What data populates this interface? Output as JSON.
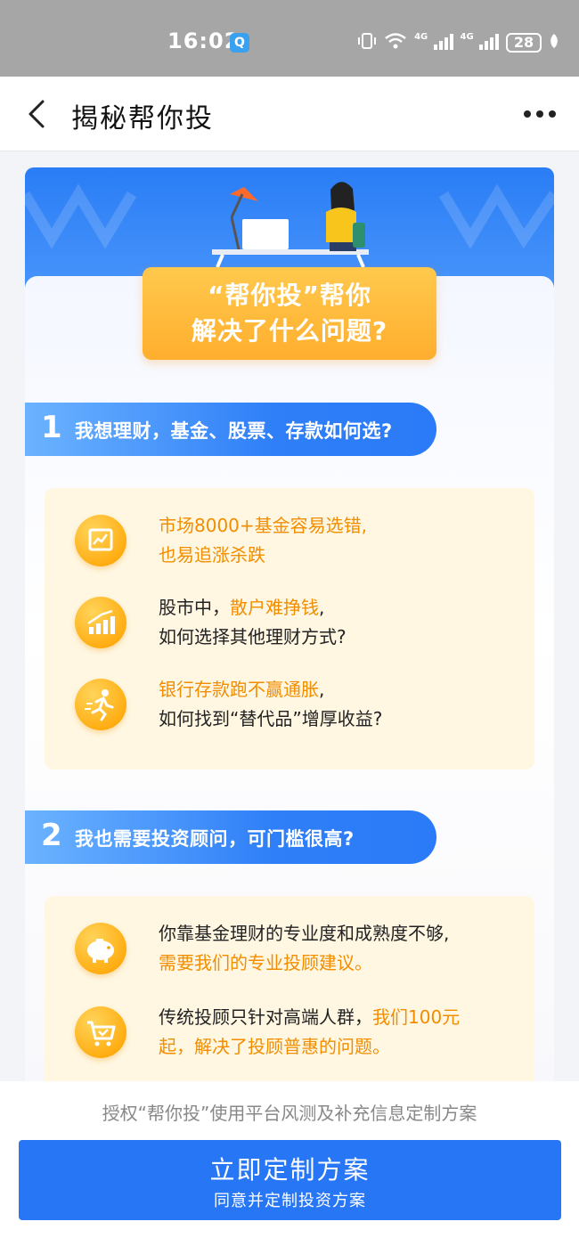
{
  "status_bar": {
    "time": "16:02",
    "battery": "28",
    "network_1": "4G",
    "network_2": "4G"
  },
  "header": {
    "title": "揭秘帮你投"
  },
  "banner": {
    "line1": "“帮你投”帮你",
    "line2": "解决了什么问题?"
  },
  "sections": [
    {
      "number": "1",
      "title": "我想理财，基金、股票、存款如何选?",
      "items": [
        {
          "icon": "chart-board-icon",
          "highlight": "市场8000+基金容易选错,",
          "line2_highlight": "也易追涨杀跌"
        },
        {
          "icon": "rising-bars-icon",
          "pre": "股市中，",
          "highlight": "散户难挣钱",
          "post": ",",
          "line2": "如何选择其他理财方式?"
        },
        {
          "icon": "running-person-icon",
          "highlight": "银行存款跑不赢通胀",
          "post": ",",
          "line2": "如何找到“替代品”增厚收益?"
        }
      ]
    },
    {
      "number": "2",
      "title": "我也需要投资顾问，可门槛很高?",
      "items": [
        {
          "icon": "piggy-bank-icon",
          "line1": "你靠基金理财的专业度和成熟度不够,",
          "line2_highlight": "需要我们的专业投顾建议。"
        },
        {
          "icon": "shopping-cart-icon",
          "pre": "传统投顾只针对高端人群，",
          "highlight": "我们100元",
          "line2_highlight": "起，解决了投顾普惠的问题。"
        }
      ]
    }
  ],
  "bottom": {
    "consent": "授权“帮你投”使用平台风测及补充信息定制方案",
    "cta_main": "立即定制方案",
    "cta_sub": "同意并定制投资方案"
  },
  "colors": {
    "primary_blue": "#2676f5",
    "highlight_orange": "#f28d00",
    "item_bg": "#fff7e2"
  }
}
